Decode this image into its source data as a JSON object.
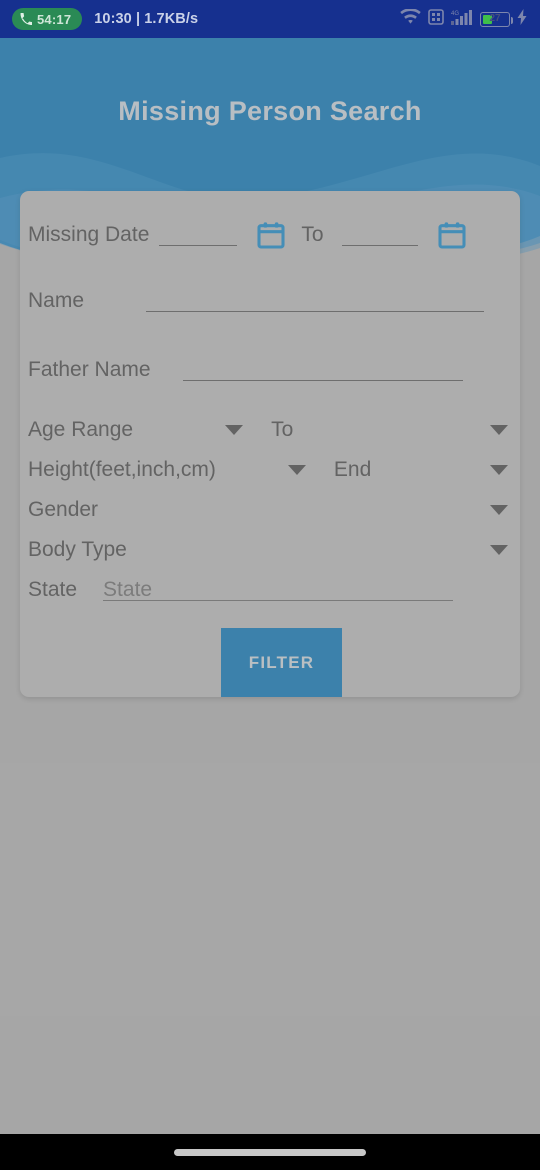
{
  "status_bar": {
    "call_timer": "54:17",
    "clock_and_net": "10:30 | 1.7KB/s",
    "network_type": "4G",
    "battery_percent": "27",
    "icons": [
      "phone-icon",
      "wifi-icon",
      "sim-card-icon",
      "signal-bars-icon",
      "battery-icon",
      "charging-bolt-icon"
    ]
  },
  "header": {
    "title": "Missing Person Search",
    "background_color": "#1275b1",
    "wave_color": "#2a85bd"
  },
  "form": {
    "missing_date": {
      "label": "Missing Date",
      "from_value": "",
      "to_label": "To",
      "to_value": "",
      "start_calendar_icon": "calendar-icon",
      "end_calendar_icon": "calendar-icon"
    },
    "name": {
      "label": "Name",
      "value": ""
    },
    "father_name": {
      "label": "Father Name",
      "value": ""
    },
    "age_range": {
      "label": "Age Range",
      "start_value": "",
      "to_label": "To",
      "end_value": ""
    },
    "height": {
      "label": "Height(feet,inch,cm)",
      "start_value": "",
      "end_label": "End",
      "end_value": ""
    },
    "gender": {
      "label": "Gender",
      "value": ""
    },
    "body_type": {
      "label": "Body Type",
      "value": ""
    },
    "state": {
      "label": "State",
      "placeholder": "State",
      "value": ""
    },
    "submit_label": "FILTER",
    "submit_color": "#1275b1",
    "card_color": "#b4b4b4"
  },
  "navigation": {
    "home_indicator": "home-indicator"
  }
}
